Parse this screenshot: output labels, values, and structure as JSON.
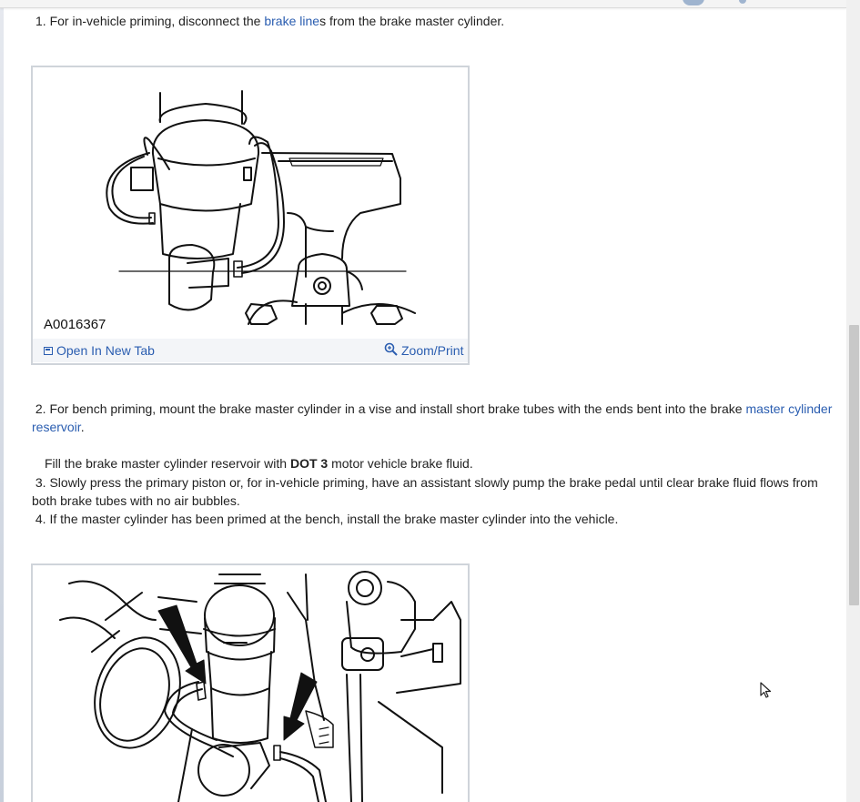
{
  "steps": [
    {
      "num": "1.",
      "pre": "For in-vehicle priming, disconnect the ",
      "link": "brake line",
      "post": "s from the brake master cylinder."
    },
    {
      "num": "2.",
      "pre": "For bench priming, mount the brake master cylinder in a vise and install short brake tubes with the ends bent into the brake ",
      "link": "master cylinder reservoir",
      "post": "."
    },
    {
      "pre": "Fill the brake master cylinder reservoir with ",
      "bold": "DOT 3",
      "post": " motor vehicle brake fluid."
    },
    {
      "num": "3.",
      "text": "Slowly press the primary piston or, for in-vehicle priming, have an assistant slowly pump the brake pedal until clear brake fluid flows from both brake tubes with no air bubbles."
    },
    {
      "num": "4.",
      "text": "If the master cylinder has been primed at the bench, install the brake master cylinder into the vehicle."
    }
  ],
  "figures": [
    {
      "caption": "A0016367",
      "open_label": "Open In New Tab",
      "zoom_label": "Zoom/Print"
    }
  ],
  "icons": {
    "open": "open-in-new-tab-icon",
    "zoom": "zoom-icon",
    "cursor": "mouse-pointer-icon"
  },
  "colors": {
    "link": "#2a5db0",
    "figure_border": "#cfd4da",
    "toolbar_bg": "#f3f5f8"
  }
}
